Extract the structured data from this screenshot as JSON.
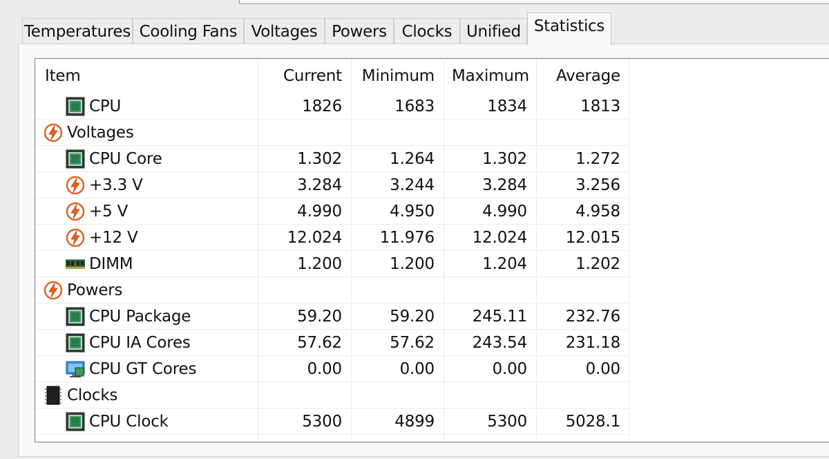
{
  "tabs": [
    {
      "label": "Temperatures",
      "active": false
    },
    {
      "label": "Cooling Fans",
      "active": false
    },
    {
      "label": "Voltages",
      "active": false
    },
    {
      "label": "Powers",
      "active": false
    },
    {
      "label": "Clocks",
      "active": false
    },
    {
      "label": "Unified",
      "active": false
    },
    {
      "label": "Statistics",
      "active": true
    }
  ],
  "table": {
    "columns": [
      "Item",
      "Current",
      "Minimum",
      "Maximum",
      "Average"
    ],
    "rows": [
      {
        "label": "CPU",
        "icon": "cpu-chip-icon",
        "child": true,
        "current": "1826",
        "minimum": "1683",
        "maximum": "1834",
        "average": "1813"
      },
      {
        "label": "Voltages",
        "icon": "voltage-bolt-icon",
        "child": false,
        "current": "",
        "minimum": "",
        "maximum": "",
        "average": ""
      },
      {
        "label": "CPU Core",
        "icon": "cpu-chip-icon",
        "child": true,
        "current": "1.302",
        "minimum": "1.264",
        "maximum": "1.302",
        "average": "1.272"
      },
      {
        "label": "+3.3 V",
        "icon": "voltage-bolt-icon",
        "child": true,
        "current": "3.284",
        "minimum": "3.244",
        "maximum": "3.284",
        "average": "3.256"
      },
      {
        "label": "+5 V",
        "icon": "voltage-bolt-icon",
        "child": true,
        "current": "4.990",
        "minimum": "4.950",
        "maximum": "4.990",
        "average": "4.958"
      },
      {
        "label": "+12 V",
        "icon": "voltage-bolt-icon",
        "child": true,
        "current": "12.024",
        "minimum": "11.976",
        "maximum": "12.024",
        "average": "12.015"
      },
      {
        "label": "DIMM",
        "icon": "memory-module-icon",
        "child": true,
        "current": "1.200",
        "minimum": "1.200",
        "maximum": "1.204",
        "average": "1.202"
      },
      {
        "label": "Powers",
        "icon": "voltage-bolt-icon",
        "child": false,
        "current": "",
        "minimum": "",
        "maximum": "",
        "average": ""
      },
      {
        "label": "CPU Package",
        "icon": "cpu-chip-icon",
        "child": true,
        "current": "59.20",
        "minimum": "59.20",
        "maximum": "245.11",
        "average": "232.76"
      },
      {
        "label": "CPU IA Cores",
        "icon": "cpu-chip-icon",
        "child": true,
        "current": "57.62",
        "minimum": "57.62",
        "maximum": "243.54",
        "average": "231.18"
      },
      {
        "label": "CPU GT Cores",
        "icon": "gpu-monitor-icon",
        "child": true,
        "current": "0.00",
        "minimum": "0.00",
        "maximum": "0.00",
        "average": "0.00"
      },
      {
        "label": "Clocks",
        "icon": "clock-chip-icon",
        "child": false,
        "current": "",
        "minimum": "",
        "maximum": "",
        "average": ""
      },
      {
        "label": "CPU Clock",
        "icon": "cpu-chip-icon",
        "child": true,
        "current": "5300",
        "minimum": "4899",
        "maximum": "5300",
        "average": "5028.1"
      }
    ]
  }
}
